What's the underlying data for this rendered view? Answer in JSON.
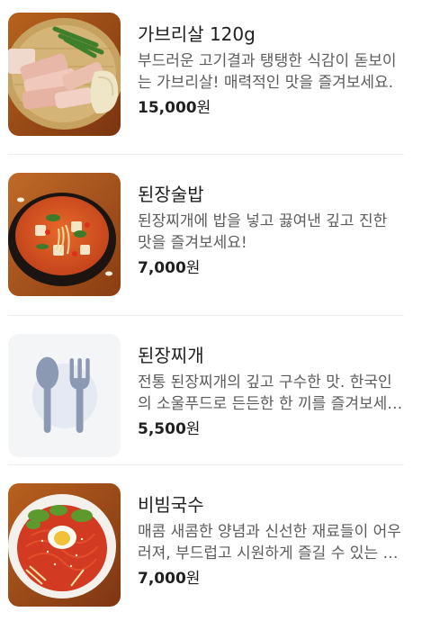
{
  "menu": {
    "items": [
      {
        "name": "가브리살 120g",
        "description": "부드러운 고기결과 탱탱한 식감이 돋보이는 가브리살! 매력적인 맛을 즐겨보세요.",
        "price": "15,000",
        "currency": "원",
        "image": "grilled-pork-photo"
      },
      {
        "name": "된장술밥",
        "description": "된장찌개에 밥을 넣고 끓여낸 깊고 진한 맛을 즐겨보세요!",
        "price": "7,000",
        "currency": "원",
        "image": "doenjang-rice-stew-photo"
      },
      {
        "name": "된장찌개",
        "description": "전통 된장찌개의 깊고 구수한 맛. 한국인의 소울푸드로 든든한 한 끼를 즐겨보세요.",
        "price": "5,500",
        "currency": "원",
        "image": "utensils-icon"
      },
      {
        "name": "비빔국수",
        "description": "매콤 새콤한 양념과 신선한 재료들이 어우러져, 부드럽고 시원하게 즐길 수 있는 비빔국수.",
        "price": "7,000",
        "currency": "원",
        "image": "bibim-noodle-photo"
      }
    ]
  },
  "colors": {
    "text_primary": "#1f1f1f",
    "text_secondary": "#5c5c5c",
    "placeholder_bg": "#f4f5f7",
    "placeholder_icon": "#8c99b3"
  }
}
